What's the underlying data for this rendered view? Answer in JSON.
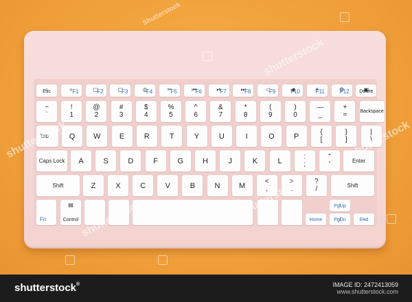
{
  "watermark": {
    "text": "shutterstock",
    "corner_mark": "Shutterstock"
  },
  "footer": {
    "brand": "shutterstock",
    "brand_mark": "®",
    "image_id_label": "IMAGE ID: 2472413059",
    "site": "www.shutterstock.com"
  },
  "colors": {
    "background": "#f2a33f",
    "keyboard": "#f5d6d3",
    "key": "#fdfdfd",
    "fn_blue": "#2f6fc7"
  },
  "keyboard": {
    "row0": [
      {
        "id": "esc",
        "label": "Esc",
        "icon": "home-icon"
      },
      {
        "id": "f1",
        "blue": "F1",
        "icon": "search-icon"
      },
      {
        "id": "f2",
        "blue": "F2",
        "icon": "window-icon"
      },
      {
        "id": "f3",
        "blue": "F3",
        "icon": "window-icon"
      },
      {
        "id": "f4",
        "blue": "F4",
        "icon": "globe-icon"
      },
      {
        "id": "f5",
        "blue": "F5",
        "icon": "scissors-icon"
      },
      {
        "id": "f6",
        "blue": "F6",
        "icon": "prev-track-icon",
        "glyph": "⏮"
      },
      {
        "id": "f7",
        "blue": "F7",
        "icon": "play-pause-icon",
        "glyph": "⏯"
      },
      {
        "id": "f8",
        "blue": "F8",
        "icon": "next-track-icon",
        "glyph": "⏭"
      },
      {
        "id": "f9",
        "blue": "F9",
        "icon": "volume-down-icon"
      },
      {
        "id": "f10",
        "blue": "F10",
        "icon": "volume-up-icon"
      },
      {
        "id": "f11",
        "blue": "F11",
        "icon": "brightness-icon"
      },
      {
        "id": "f12",
        "blue": "F12",
        "icon": "settings-icon"
      },
      {
        "id": "delete",
        "label": "Delete",
        "icon": "lock-icon"
      }
    ],
    "row1": [
      {
        "top": "~",
        "bot": "`"
      },
      {
        "top": "!",
        "bot": "1"
      },
      {
        "top": "@",
        "bot": "2"
      },
      {
        "top": "#",
        "bot": "3"
      },
      {
        "top": "$",
        "bot": "4"
      },
      {
        "top": "%",
        "bot": "5"
      },
      {
        "top": "^",
        "bot": "6"
      },
      {
        "top": "&",
        "bot": "7"
      },
      {
        "top": "*",
        "bot": "8"
      },
      {
        "top": "(",
        "bot": "9"
      },
      {
        "top": ")",
        "bot": "0"
      },
      {
        "top": "—",
        "bot": "_"
      },
      {
        "top": "+",
        "bot": "="
      },
      {
        "label": "Backspace"
      }
    ],
    "row2": [
      "Tab",
      "Q",
      "W",
      "E",
      "R",
      "T",
      "Y",
      "U",
      "I",
      "O",
      "P",
      {
        "top": "{",
        "bot": "["
      },
      {
        "top": "}",
        "bot": "]"
      },
      {
        "top": "|",
        "bot": "\\"
      }
    ],
    "row3": [
      "Caps Lock",
      "A",
      "S",
      "D",
      "F",
      "G",
      "H",
      "J",
      "K",
      "L",
      {
        "top": ":",
        "bot": ";"
      },
      {
        "top": "\"",
        "bot": "'"
      },
      "Enter"
    ],
    "row4": [
      "Shift",
      "Z",
      "X",
      "C",
      "V",
      "B",
      "N",
      "M",
      {
        "top": "<",
        "bot": ","
      },
      {
        "top": ">",
        "bot": "."
      },
      {
        "top": "?",
        "bot": "/"
      },
      "Shift"
    ],
    "row5": {
      "fn": "Fn",
      "control": "Control",
      "pgup": "PgUp",
      "home": "Home",
      "pgdn": "PgDn",
      "end": "End"
    }
  }
}
